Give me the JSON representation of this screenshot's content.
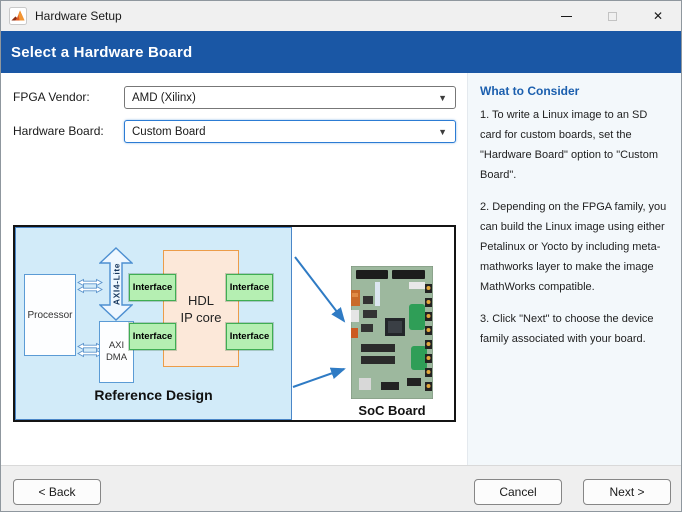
{
  "window": {
    "title": "Hardware Setup"
  },
  "icons": {
    "close_glyph": "✕",
    "dropdown_glyph": "▼"
  },
  "header": {
    "title": "Select a Hardware Board"
  },
  "form": {
    "fpga_vendor_label": "FPGA Vendor:",
    "fpga_vendor_value": "AMD (Xilinx)",
    "hardware_board_label": "Hardware Board:",
    "hardware_board_value": "Custom Board"
  },
  "diagram": {
    "processor": "Processor",
    "axi4_lite": "AXI4-Lite",
    "axi_dma_line1": "AXI",
    "axi_dma_line2": "DMA",
    "hdl_line1": "HDL",
    "hdl_line2": "IP core",
    "interface": "Interface",
    "reference_design": "Reference Design",
    "soc_board": "SoC Board"
  },
  "sidebar": {
    "title": "What to Consider",
    "paragraphs": [
      "1. To write a Linux image to an SD card for custom boards, set the \"Hardware Board\" option to \"Custom Board\".",
      "2. Depending on the FPGA family, you can build the Linux image using either Petalinux or Yocto by including meta-mathworks layer to make the image MathWorks compatible.",
      "3. Click \"Next\" to choose the device family associated with your board."
    ]
  },
  "footer": {
    "back": "< Back",
    "cancel": "Cancel",
    "next": "Next >"
  },
  "colors": {
    "header_blue": "#1a57a5",
    "arrow_blue": "#2f7bc4",
    "panel_bg": "#f3f8fb",
    "diagram_blue_bg": "#d2ebf9",
    "hdl_fill": "#fce8d9",
    "hdl_border": "#ec9c49",
    "interface_fill": "#b5efb2",
    "interface_border": "#3fae53"
  }
}
